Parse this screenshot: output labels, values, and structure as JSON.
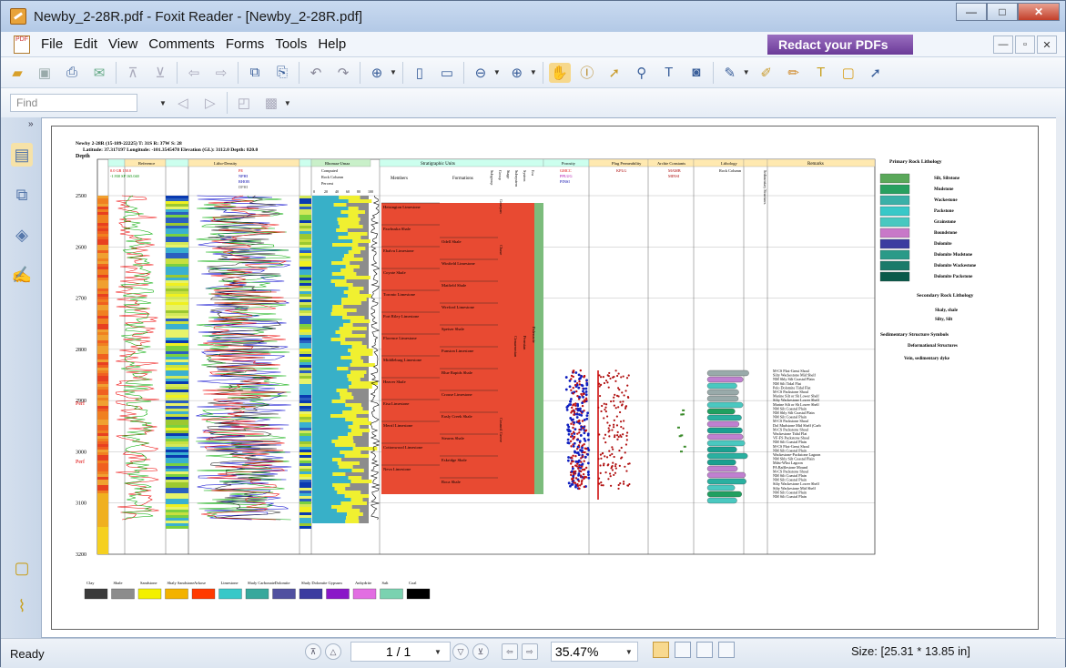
{
  "window": {
    "title": "Newby_2-28R.pdf - Foxit Reader - [Newby_2-28R.pdf]",
    "min": "—",
    "max": "□",
    "close": "✕"
  },
  "menu": {
    "items": [
      "File",
      "Edit",
      "View",
      "Comments",
      "Forms",
      "Tools",
      "Help"
    ],
    "redact": "Redact your PDFs"
  },
  "toolbar": {
    "find_placeholder": "Find"
  },
  "status": {
    "ready": "Ready",
    "page": "1 / 1",
    "zoom": "35.47%",
    "size": "Size: [25.31 * 13.85 in]"
  },
  "log": {
    "header1": "Newby 2-28R (15-189-22225) T: 31S R: 37W S: 28",
    "header2": "Latitude: 37.317197 Longitude: -101.3545478 Elevation (GL): 3112.0 Depth: 820.0",
    "depth_label": "Depth",
    "depths": [
      "2500",
      "2600",
      "2700",
      "2800",
      "2900",
      "3000",
      "3100",
      "3200"
    ],
    "perf": [
      "Perf",
      "Perf"
    ],
    "tracks": [
      "Reference",
      "Litho-Density",
      "Rhomaa-Umaa",
      "Stratigraphic Units",
      "Porosity",
      "Plug Permeability",
      "Archie Constants",
      "Lithology",
      "Remarks"
    ],
    "ref_curves": [
      "GR",
      "SP"
    ],
    "ref_vals": [
      "0.0   GR   150.0",
      "-1.930   SP   165.040"
    ],
    "ld_curves": [
      "PE",
      "NPHI",
      "RHOB",
      "DPHI"
    ],
    "rhomaa_sub": [
      "Computed",
      "Rock Column",
      "Percent"
    ],
    "rhomaa_axis": [
      "0",
      "20",
      "40",
      "60",
      "80",
      "100"
    ],
    "strat_cols": [
      "Members",
      "Formations"
    ],
    "strat_vertical": [
      "Subgroup",
      "Group",
      "Stage",
      "Subsystem",
      "System",
      "Era"
    ],
    "members": [
      "Heisington Limestone",
      "Pawhuska Shale",
      "Ebalvu Limestone",
      "Coyote Shale",
      "Toronto Limestone",
      "Fort Riley Limestone",
      "Florence Limestone",
      "Middleburg Limestone",
      "Heaver Shale",
      "Eisa Limestone",
      "Merril Limestone",
      "Cottonwood Limestone",
      "Neva Limestone"
    ],
    "formations": [
      "Odell Shale",
      "Winfield Limestone",
      "Matfield Shale",
      "Wreford Limestone",
      "Speiser Shale",
      "Funston Limestone",
      "Blue Rapids Shale",
      "Crouse Limestone",
      "Easly Creek Shale",
      "Stearns Shale",
      "Eskridge Shale",
      "Roca Shale"
    ],
    "strat_groups": [
      "Chase",
      "Council Grove",
      "Cimarronian",
      "Permian",
      "Paleozoic",
      "Gearyan"
    ],
    "porosity": [
      "GMCC",
      "PPLUG",
      "PINSI"
    ],
    "perm": [
      "KPLG"
    ],
    "archie": [
      "MAMB",
      "MINSI"
    ],
    "lith_head": "Rock Column",
    "sed_head": "Sedimentary Structures",
    "remarks": [
      "M-CS Fkst-Grnst Shoal",
      "Silty Wackestone Mid Shelf",
      "NM Shly Silt Coastal Plain",
      "NM Silt Tidal Flat",
      "Pelo Dolomite Tidal Flat",
      "M-CS Packstone Shoal",
      "Marine Silt or Sh Lower Shelf",
      "Silty Wackestone Lower Shelf",
      "Marine Silt or Sh Lower Shelf",
      "NM Silt Coastal Plain",
      "NM Shly Silt Coastal Plain",
      "NM Silt Coastal Plain",
      "M-CS Packstone Shoal",
      "Dol Mudstone Mid Shelf (Carb",
      "M-CS Packstone Shoal",
      "Wackestone Tidal Flat",
      "VF-FS Packstone Shoal",
      "NM Silt Coastal Plain",
      "M-CS Fkst-Grnst Shoal",
      "NM Silt Coastal Plain",
      "Wackestone-Packstone Lagoon",
      "NM Shly Silt Coastal Plain",
      "Mdst-Wkst Lagoon",
      "PA Bafflestone Mound",
      "M-CS Packstone Shoal",
      "NM Silt Coastal Plain",
      "NM Silt Coastal Plain",
      "Silty Wackestone Lower Shelf",
      "Silty Wackestone Mid Shelf",
      "NM Silt Coastal Plain",
      "NM Silt Coastal Plain"
    ],
    "primary_title": "Primary Rock Lithology",
    "primary": [
      "Silt, Siltstone",
      "Mudstone",
      "Wackestone",
      "Packstone",
      "Grainstone",
      "Boundstone",
      "Dolomite",
      "Dolomite Mudstone",
      "Dolomite Wackestone",
      "Dolomite Packstone"
    ],
    "secondary_title": "Secondary Rock Lithology",
    "secondary": [
      "Shaly, shale",
      "Silty, Silt"
    ],
    "sed_title": "Sedimentary Structure Symbols",
    "deform_title": "Deformational Structures",
    "vein": "Vein, sedimentary dyke",
    "legend": [
      "Clay",
      "Shale",
      "Sandstone",
      "Shaly Sandstone",
      "Arkose",
      "Limestone",
      "Shaly Carbonate",
      "Dolomite",
      "Shaly Dolomite",
      "Gypsum",
      "Anhydrite",
      "Salt",
      "Coal"
    ],
    "legend_colors": [
      "#3a3a3a",
      "#8c8c8c",
      "#f3f000",
      "#f3b200",
      "#ff3a00",
      "#38c8c8",
      "#38a89c",
      "#5050a0",
      "#3c3ca0",
      "#8a18c8",
      "#e26ee2",
      "#7ad2b0",
      "#000000"
    ]
  }
}
